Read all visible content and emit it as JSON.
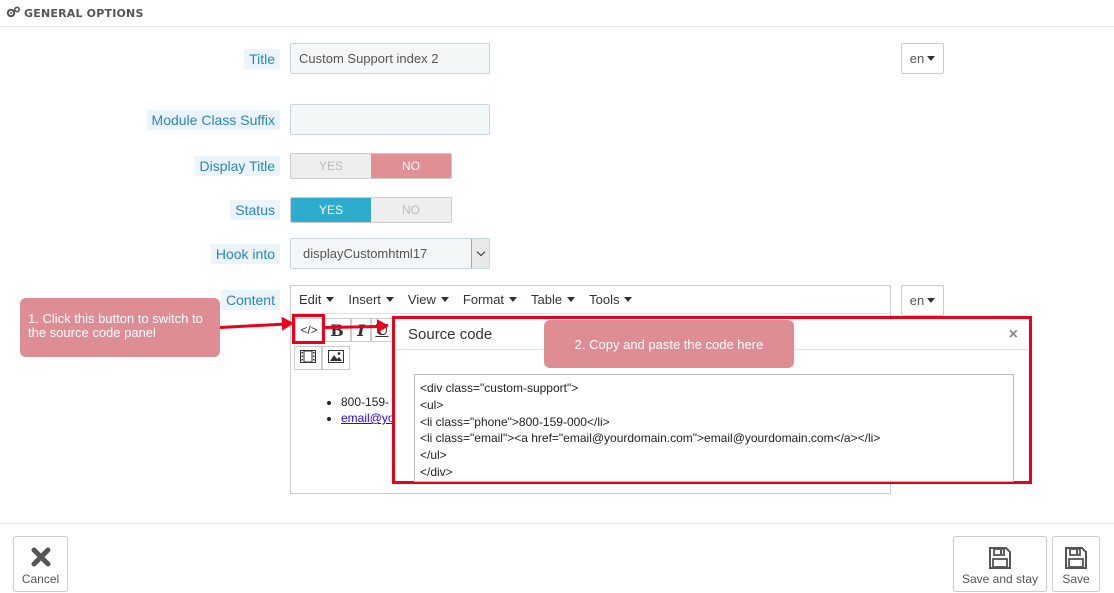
{
  "panel": {
    "title": "GENERAL OPTIONS",
    "icon": "gears-icon"
  },
  "fields": {
    "title": {
      "label": "Title",
      "value": "Custom Support index 2",
      "lang": "en"
    },
    "module_class_suffix": {
      "label": "Module Class Suffix",
      "value": ""
    },
    "display_title": {
      "label": "Display Title",
      "yes": "YES",
      "no": "NO",
      "selected": "NO"
    },
    "status": {
      "label": "Status",
      "yes": "YES",
      "no": "NO",
      "selected": "YES"
    },
    "hook_into": {
      "label": "Hook into",
      "value": "displayCustomhtml17"
    },
    "content": {
      "label": "Content",
      "lang": "en"
    }
  },
  "editor": {
    "menu": [
      "Edit",
      "Insert",
      "View",
      "Format",
      "Table",
      "Tools"
    ],
    "toolbar": {
      "source_code": "</>",
      "bold": "B",
      "italic": "I",
      "underline": "U"
    },
    "content_items": [
      "800-159-",
      "email@yo"
    ]
  },
  "callouts": {
    "step1": "1. Click this button to switch to the source code panel",
    "step2": "2. Copy and paste the code here"
  },
  "modal": {
    "title": "Source code",
    "close": "×",
    "code": "<div class=\"custom-support\">\n<ul>\n<li class=\"phone\">800-159-000</li>\n<li class=\"email\"><a href=\"email@yourdomain.com\">email@yourdomain.com</a></li>\n</ul>\n</div>"
  },
  "footer": {
    "cancel": "Cancel",
    "save_and_stay": "Save and stay",
    "save": "Save"
  },
  "colors": {
    "label_bg": "#eaf4fa",
    "label_text": "#2a87b7",
    "yes_active": "#2eacce",
    "no_active": "#e08f95",
    "annotation_red": "#e8001c",
    "callout_bg": "#de8d94"
  }
}
